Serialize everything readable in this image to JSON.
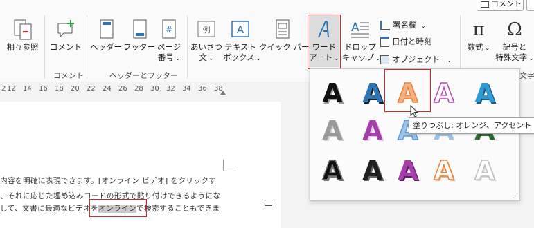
{
  "top_right": {
    "comment_button": "コメント"
  },
  "ribbon": {
    "buttons": {
      "aisatsu": "相互参照",
      "comment": "コメント",
      "header": "ヘッダー",
      "footer": "フッター",
      "page_number_1": "ページ",
      "page_number_2": "番号",
      "greeting_1": "あいさつ",
      "greeting_2": "文",
      "textbox_1": "テキスト",
      "textbox_2": "ボックス",
      "quickparts": "クイック パーツ",
      "wordart_1": "ワード",
      "wordart_2": "アート",
      "dropcap_1": "ドロップ",
      "dropcap_2": "キャップ",
      "signature": "署名欄",
      "datetime": "日付と時刻",
      "object": "オブジェクト",
      "equation": "数式",
      "symbol_1": "記号と",
      "symbol_2": "特殊文字"
    },
    "groups": {
      "comment": "コメント",
      "header_footer": "ヘッダーとフッター",
      "symbols_partial": "文字"
    },
    "icon_glyphs": {
      "equation": "π",
      "symbol": "Ω",
      "example": "例"
    }
  },
  "ruler": {
    "ticks": [
      "2",
      "12",
      "14",
      "16",
      "18",
      "20",
      "22",
      "24",
      "26",
      "28",
      "30",
      "32",
      "34",
      "36",
      "38"
    ]
  },
  "document": {
    "line1": "内容を明確に表現できます。[オンライン ビデオ] をクリックす",
    "line2": "、それに応じた埋め込みコードの形式で貼り付けできるようにな",
    "line3_before": "して、文書に最適なビデオを",
    "line3_highlight": "オンライン",
    "line3_after": "で検索することもできま"
  },
  "wordart_gallery": {
    "glyph": "A",
    "styles": [
      {
        "fill": "#111111",
        "outline": "none",
        "shadow": "#999999"
      },
      {
        "fill": "#2e75b6",
        "outline": "none",
        "shadow": "#1f1f1f"
      },
      {
        "fill": "#f4b183",
        "outline": "#ed7d31",
        "shadow": "none"
      },
      {
        "fill": "#ffffff",
        "outline": "#b044b4",
        "shadow": "none"
      },
      {
        "fill": "#2e9bd6",
        "outline": "none",
        "shadow": "#1a5a80"
      },
      {
        "fill": "#9a9a9a",
        "outline": "none",
        "shadow": "#d0d0d0"
      },
      {
        "fill": "#a53ea8",
        "outline": "none",
        "shadow": "#e8c8ea"
      },
      {
        "fill": "#9dc3e6",
        "outline": "#5b9bd5",
        "shadow": "none"
      },
      {
        "fill": "#9dc3e6",
        "outline": "none",
        "shadow": "none"
      },
      {
        "fill": "#2f6b2f",
        "outline": "none",
        "shadow": "none"
      },
      {
        "fill": "#111111",
        "outline": "#777777",
        "shadow": "#777777"
      },
      {
        "fill": "#1f1f1f",
        "outline": "none",
        "shadow": "#666666"
      },
      {
        "fill": "#a53ea8",
        "outline": "none",
        "shadow": "#5a1f5c"
      },
      {
        "fill": "#ffffff",
        "outline": "#ed7d31",
        "shadow": "#f4b183"
      },
      {
        "fill": "#ffffff",
        "outline": "#bfbfbf",
        "shadow": "#d9d9d9"
      }
    ]
  },
  "tooltip": "塗りつぶし: オレンジ、アクセント カラー",
  "colors": {
    "accent_red": "#e02020",
    "highlight": "#c9c9c9"
  }
}
